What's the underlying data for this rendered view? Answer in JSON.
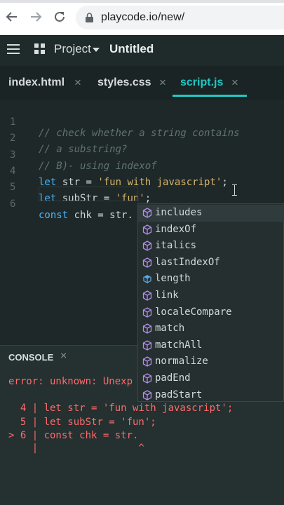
{
  "browser": {
    "url": "playcode.io/new/",
    "icons": [
      "back-arrow-icon",
      "forward-arrow-icon",
      "reload-icon",
      "lock-icon"
    ]
  },
  "header": {
    "project_label": "Project",
    "project_name": "Untitled"
  },
  "tabs": [
    {
      "label": "index.html",
      "close": "×"
    },
    {
      "label": "styles.css",
      "close": "×"
    },
    {
      "label": "script.js",
      "close": "×",
      "active": true
    }
  ],
  "editor": {
    "lines": [
      {
        "num": "1",
        "text": "// check whether a string contains"
      },
      {
        "num": "2",
        "text": "// a substring?"
      },
      {
        "num": "3",
        "text": "// B)- using indexof"
      },
      {
        "num": "4",
        "kw": "let",
        "rest": " str = ",
        "str": "'fun with javascript'",
        "end": ";"
      },
      {
        "num": "5",
        "kw": "let",
        "rest": " subStr = ",
        "str": "'fun'",
        "end": ";"
      },
      {
        "num": "6",
        "kw": "const",
        "rest": " chk = str."
      }
    ]
  },
  "autocomplete": {
    "items": [
      {
        "label": "includes",
        "icon": "method-cube-icon"
      },
      {
        "label": "indexOf",
        "icon": "method-cube-icon"
      },
      {
        "label": "italics",
        "icon": "method-cube-icon"
      },
      {
        "label": "lastIndexOf",
        "icon": "method-cube-icon"
      },
      {
        "label": "length",
        "icon": "property-icon"
      },
      {
        "label": "link",
        "icon": "method-cube-icon"
      },
      {
        "label": "localeCompare",
        "icon": "method-cube-icon"
      },
      {
        "label": "match",
        "icon": "method-cube-icon"
      },
      {
        "label": "matchAll",
        "icon": "method-cube-icon"
      },
      {
        "label": "normalize",
        "icon": "method-cube-icon"
      },
      {
        "label": "padEnd",
        "icon": "method-cube-icon"
      },
      {
        "label": "padStart",
        "icon": "method-cube-icon"
      }
    ]
  },
  "console": {
    "title": "CONSOLE",
    "close": "×",
    "error_line": "error: unknown: Unexp",
    "trace": [
      "  4 | let str = 'fun with javascript';",
      "  5 | let subStr = 'fun';",
      "> 6 | const chk = str.",
      "    |                 ^"
    ]
  },
  "colors": {
    "accent": "#1ec9c4",
    "error": "#ff6b6b",
    "keyword": "#4bb7ff",
    "string": "#d7b56d"
  }
}
